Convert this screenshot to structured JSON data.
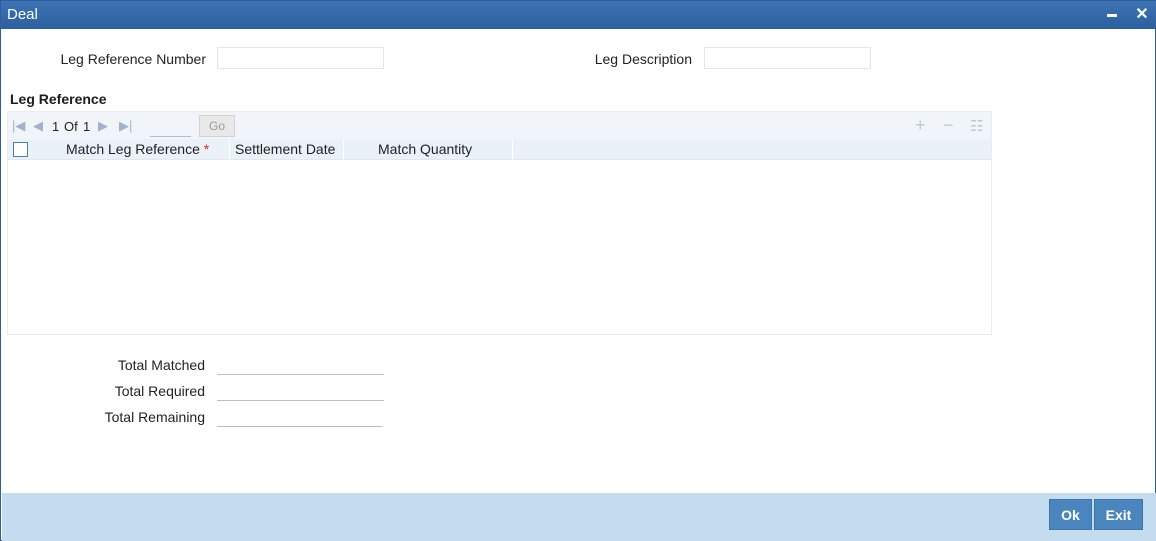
{
  "window": {
    "title": "Deal",
    "minimize_icon": "minimize-icon",
    "close_icon": "close-icon",
    "close_glyph": "✕"
  },
  "header_fields": {
    "leg_reference_number": {
      "label": "Leg Reference Number",
      "value": ""
    },
    "leg_description": {
      "label": "Leg Description",
      "value": ""
    }
  },
  "leg_reference": {
    "section_title": "Leg Reference",
    "pagination": {
      "current": "1",
      "of_label": "Of",
      "total": "1",
      "page_input": "",
      "go_label": "Go",
      "first_icon": "first-page-icon",
      "prev_icon": "prev-page-icon",
      "next_icon": "next-page-icon",
      "last_icon": "last-page-icon"
    },
    "toolbar_icons": [
      "add-row-icon",
      "delete-row-icon",
      "single-view-icon"
    ],
    "columns": [
      {
        "label": "Match Leg Reference",
        "required_mark": "*"
      },
      {
        "label": "Settlement Date"
      },
      {
        "label": "Match Quantity"
      }
    ],
    "rows": []
  },
  "totals": {
    "total_matched": {
      "label": "Total Matched",
      "value": ""
    },
    "total_required": {
      "label": "Total Required",
      "value": ""
    },
    "total_remaining": {
      "label": "Total Remaining",
      "value": ""
    }
  },
  "footer": {
    "ok_label": "Ok",
    "exit_label": "Exit"
  },
  "colors": {
    "title_bar": "#2f64a4",
    "footer_bg": "#c4dcef",
    "button_bg": "#4a86bd",
    "required": "#d12b2b"
  }
}
